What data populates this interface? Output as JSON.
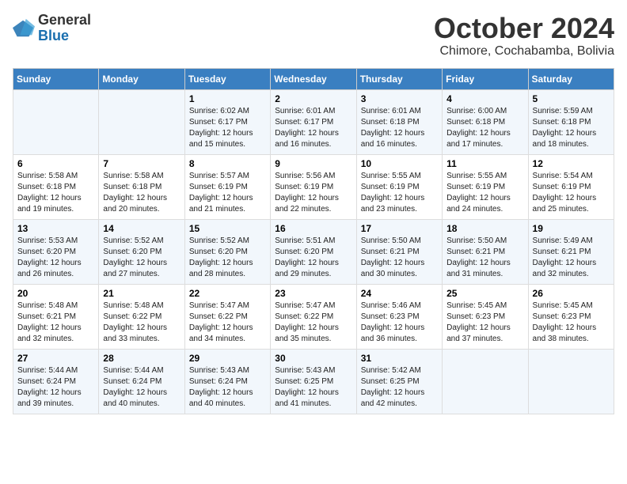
{
  "logo": {
    "text_general": "General",
    "text_blue": "Blue"
  },
  "title": "October 2024",
  "subtitle": "Chimore, Cochabamba, Bolivia",
  "days_of_week": [
    "Sunday",
    "Monday",
    "Tuesday",
    "Wednesday",
    "Thursday",
    "Friday",
    "Saturday"
  ],
  "weeks": [
    [
      {
        "day": "",
        "sunrise": "",
        "sunset": "",
        "daylight": ""
      },
      {
        "day": "",
        "sunrise": "",
        "sunset": "",
        "daylight": ""
      },
      {
        "day": "1",
        "sunrise": "Sunrise: 6:02 AM",
        "sunset": "Sunset: 6:17 PM",
        "daylight": "Daylight: 12 hours and 15 minutes."
      },
      {
        "day": "2",
        "sunrise": "Sunrise: 6:01 AM",
        "sunset": "Sunset: 6:17 PM",
        "daylight": "Daylight: 12 hours and 16 minutes."
      },
      {
        "day": "3",
        "sunrise": "Sunrise: 6:01 AM",
        "sunset": "Sunset: 6:18 PM",
        "daylight": "Daylight: 12 hours and 16 minutes."
      },
      {
        "day": "4",
        "sunrise": "Sunrise: 6:00 AM",
        "sunset": "Sunset: 6:18 PM",
        "daylight": "Daylight: 12 hours and 17 minutes."
      },
      {
        "day": "5",
        "sunrise": "Sunrise: 5:59 AM",
        "sunset": "Sunset: 6:18 PM",
        "daylight": "Daylight: 12 hours and 18 minutes."
      }
    ],
    [
      {
        "day": "6",
        "sunrise": "Sunrise: 5:58 AM",
        "sunset": "Sunset: 6:18 PM",
        "daylight": "Daylight: 12 hours and 19 minutes."
      },
      {
        "day": "7",
        "sunrise": "Sunrise: 5:58 AM",
        "sunset": "Sunset: 6:18 PM",
        "daylight": "Daylight: 12 hours and 20 minutes."
      },
      {
        "day": "8",
        "sunrise": "Sunrise: 5:57 AM",
        "sunset": "Sunset: 6:19 PM",
        "daylight": "Daylight: 12 hours and 21 minutes."
      },
      {
        "day": "9",
        "sunrise": "Sunrise: 5:56 AM",
        "sunset": "Sunset: 6:19 PM",
        "daylight": "Daylight: 12 hours and 22 minutes."
      },
      {
        "day": "10",
        "sunrise": "Sunrise: 5:55 AM",
        "sunset": "Sunset: 6:19 PM",
        "daylight": "Daylight: 12 hours and 23 minutes."
      },
      {
        "day": "11",
        "sunrise": "Sunrise: 5:55 AM",
        "sunset": "Sunset: 6:19 PM",
        "daylight": "Daylight: 12 hours and 24 minutes."
      },
      {
        "day": "12",
        "sunrise": "Sunrise: 5:54 AM",
        "sunset": "Sunset: 6:19 PM",
        "daylight": "Daylight: 12 hours and 25 minutes."
      }
    ],
    [
      {
        "day": "13",
        "sunrise": "Sunrise: 5:53 AM",
        "sunset": "Sunset: 6:20 PM",
        "daylight": "Daylight: 12 hours and 26 minutes."
      },
      {
        "day": "14",
        "sunrise": "Sunrise: 5:52 AM",
        "sunset": "Sunset: 6:20 PM",
        "daylight": "Daylight: 12 hours and 27 minutes."
      },
      {
        "day": "15",
        "sunrise": "Sunrise: 5:52 AM",
        "sunset": "Sunset: 6:20 PM",
        "daylight": "Daylight: 12 hours and 28 minutes."
      },
      {
        "day": "16",
        "sunrise": "Sunrise: 5:51 AM",
        "sunset": "Sunset: 6:20 PM",
        "daylight": "Daylight: 12 hours and 29 minutes."
      },
      {
        "day": "17",
        "sunrise": "Sunrise: 5:50 AM",
        "sunset": "Sunset: 6:21 PM",
        "daylight": "Daylight: 12 hours and 30 minutes."
      },
      {
        "day": "18",
        "sunrise": "Sunrise: 5:50 AM",
        "sunset": "Sunset: 6:21 PM",
        "daylight": "Daylight: 12 hours and 31 minutes."
      },
      {
        "day": "19",
        "sunrise": "Sunrise: 5:49 AM",
        "sunset": "Sunset: 6:21 PM",
        "daylight": "Daylight: 12 hours and 32 minutes."
      }
    ],
    [
      {
        "day": "20",
        "sunrise": "Sunrise: 5:48 AM",
        "sunset": "Sunset: 6:21 PM",
        "daylight": "Daylight: 12 hours and 32 minutes."
      },
      {
        "day": "21",
        "sunrise": "Sunrise: 5:48 AM",
        "sunset": "Sunset: 6:22 PM",
        "daylight": "Daylight: 12 hours and 33 minutes."
      },
      {
        "day": "22",
        "sunrise": "Sunrise: 5:47 AM",
        "sunset": "Sunset: 6:22 PM",
        "daylight": "Daylight: 12 hours and 34 minutes."
      },
      {
        "day": "23",
        "sunrise": "Sunrise: 5:47 AM",
        "sunset": "Sunset: 6:22 PM",
        "daylight": "Daylight: 12 hours and 35 minutes."
      },
      {
        "day": "24",
        "sunrise": "Sunrise: 5:46 AM",
        "sunset": "Sunset: 6:23 PM",
        "daylight": "Daylight: 12 hours and 36 minutes."
      },
      {
        "day": "25",
        "sunrise": "Sunrise: 5:45 AM",
        "sunset": "Sunset: 6:23 PM",
        "daylight": "Daylight: 12 hours and 37 minutes."
      },
      {
        "day": "26",
        "sunrise": "Sunrise: 5:45 AM",
        "sunset": "Sunset: 6:23 PM",
        "daylight": "Daylight: 12 hours and 38 minutes."
      }
    ],
    [
      {
        "day": "27",
        "sunrise": "Sunrise: 5:44 AM",
        "sunset": "Sunset: 6:24 PM",
        "daylight": "Daylight: 12 hours and 39 minutes."
      },
      {
        "day": "28",
        "sunrise": "Sunrise: 5:44 AM",
        "sunset": "Sunset: 6:24 PM",
        "daylight": "Daylight: 12 hours and 40 minutes."
      },
      {
        "day": "29",
        "sunrise": "Sunrise: 5:43 AM",
        "sunset": "Sunset: 6:24 PM",
        "daylight": "Daylight: 12 hours and 40 minutes."
      },
      {
        "day": "30",
        "sunrise": "Sunrise: 5:43 AM",
        "sunset": "Sunset: 6:25 PM",
        "daylight": "Daylight: 12 hours and 41 minutes."
      },
      {
        "day": "31",
        "sunrise": "Sunrise: 5:42 AM",
        "sunset": "Sunset: 6:25 PM",
        "daylight": "Daylight: 12 hours and 42 minutes."
      },
      {
        "day": "",
        "sunrise": "",
        "sunset": "",
        "daylight": ""
      },
      {
        "day": "",
        "sunrise": "",
        "sunset": "",
        "daylight": ""
      }
    ]
  ]
}
